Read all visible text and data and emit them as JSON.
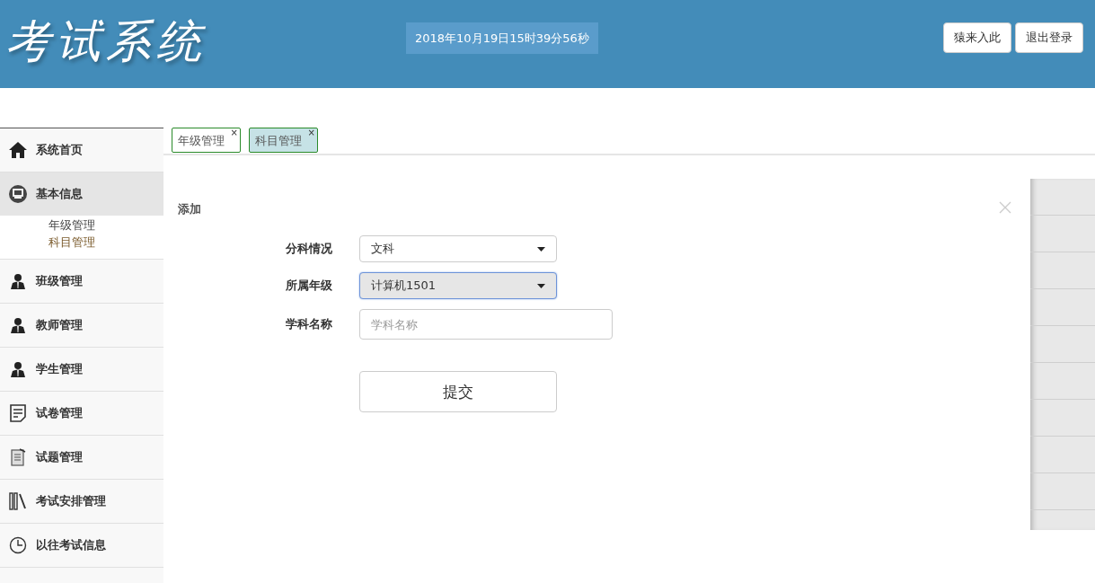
{
  "header": {
    "logo": "考试系统",
    "datetime": "2018年10月19日15时39分56秒",
    "buttons": [
      "猿来入此",
      "退出登录"
    ]
  },
  "sidebar": {
    "items": [
      {
        "label": "系统首页",
        "selected": false
      },
      {
        "label": "基本信息",
        "selected": true,
        "children": [
          {
            "label": "年级管理",
            "selected": false
          },
          {
            "label": "科目管理",
            "selected": true
          }
        ]
      },
      {
        "label": "班级管理",
        "selected": false
      },
      {
        "label": "教师管理",
        "selected": false
      },
      {
        "label": "学生管理",
        "selected": false
      },
      {
        "label": "试卷管理",
        "selected": false
      },
      {
        "label": "试题管理",
        "selected": false
      },
      {
        "label": "考试安排管理",
        "selected": false
      },
      {
        "label": "以往考试信息",
        "selected": false
      }
    ]
  },
  "tabs": [
    {
      "label": "年级管理",
      "close": "×",
      "selected": false
    },
    {
      "label": "科目管理",
      "close": "×",
      "selected": true
    }
  ],
  "dialog": {
    "title": "添加",
    "fields": [
      {
        "kind": "select",
        "label": "分科情况",
        "value": "文科",
        "focused": false
      },
      {
        "kind": "select",
        "label": "所属年级",
        "value": "计算机1501",
        "focused": true
      },
      {
        "kind": "input",
        "label": "学科名称",
        "placeholder": "学科名称"
      }
    ],
    "submit": "提交"
  }
}
